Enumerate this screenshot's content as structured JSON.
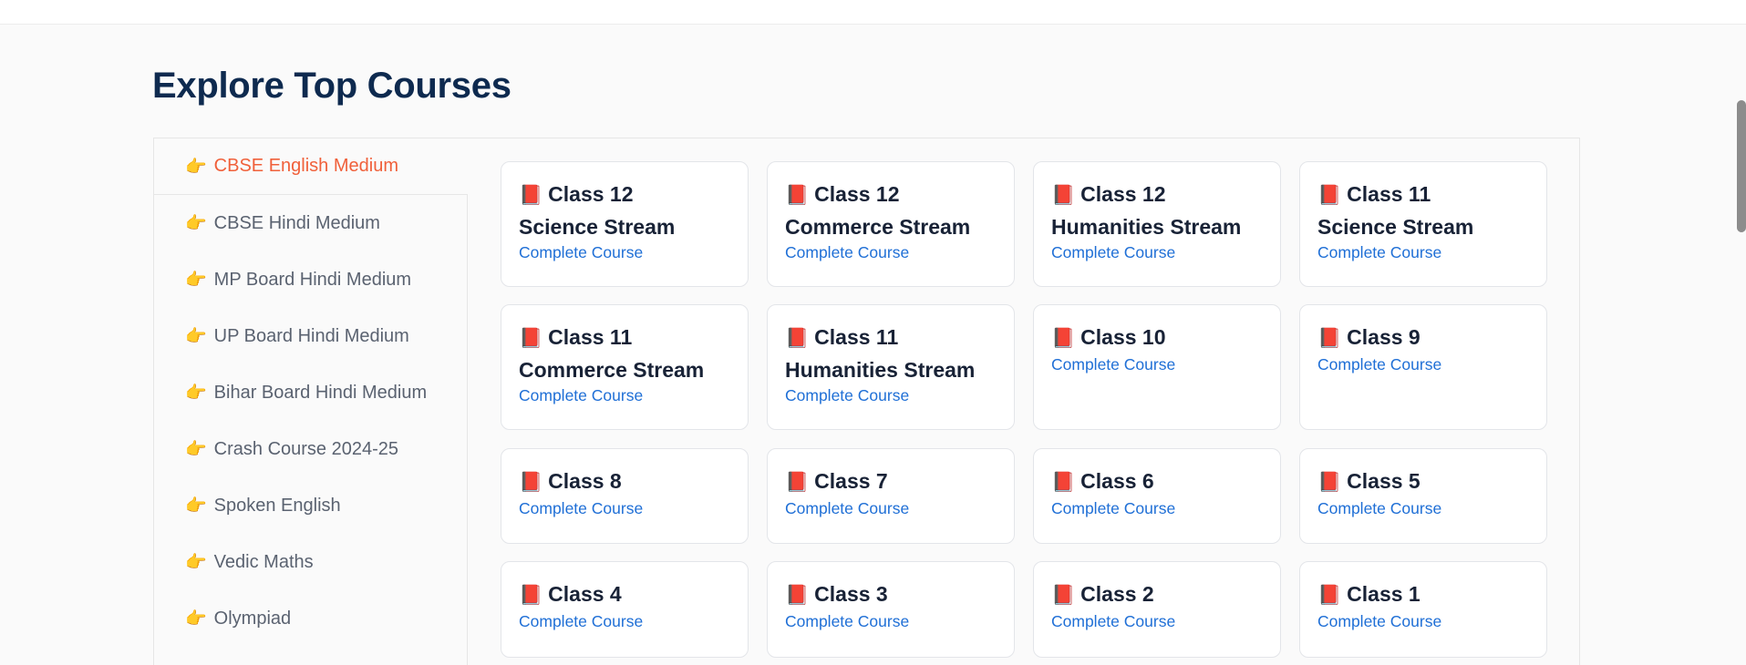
{
  "header": {
    "title": "Explore Top Courses"
  },
  "sidebar": {
    "pointer_icon": "👉",
    "items": [
      {
        "label": "CBSE English Medium",
        "active": true
      },
      {
        "label": "CBSE Hindi Medium"
      },
      {
        "label": "MP Board Hindi Medium"
      },
      {
        "label": "UP Board Hindi Medium"
      },
      {
        "label": "Bihar Board Hindi Medium"
      },
      {
        "label": "Crash Course 2024-25"
      },
      {
        "label": "Spoken English"
      },
      {
        "label": "Vedic Maths"
      },
      {
        "label": "Olympiad"
      }
    ]
  },
  "courses": {
    "book_icon": "📕",
    "link_label": "Complete Course",
    "items": [
      {
        "title": "Class 12",
        "subtitle": "Science Stream"
      },
      {
        "title": "Class 12",
        "subtitle": "Commerce Stream"
      },
      {
        "title": "Class 12",
        "subtitle": "Humanities Stream"
      },
      {
        "title": "Class 11",
        "subtitle": "Science Stream"
      },
      {
        "title": "Class 11",
        "subtitle": "Commerce Stream"
      },
      {
        "title": "Class 11",
        "subtitle": "Humanities Stream"
      },
      {
        "title": "Class 10",
        "subtitle": ""
      },
      {
        "title": "Class 9",
        "subtitle": ""
      },
      {
        "title": "Class 8",
        "subtitle": ""
      },
      {
        "title": "Class 7",
        "subtitle": ""
      },
      {
        "title": "Class 6",
        "subtitle": ""
      },
      {
        "title": "Class 5",
        "subtitle": ""
      },
      {
        "title": "Class 4",
        "subtitle": ""
      },
      {
        "title": "Class 3",
        "subtitle": ""
      },
      {
        "title": "Class 2",
        "subtitle": ""
      },
      {
        "title": "Class 1",
        "subtitle": ""
      }
    ]
  },
  "colors": {
    "title": "#0e2a4f",
    "active_tab": "#f0603a",
    "link": "#1f6fd6"
  }
}
